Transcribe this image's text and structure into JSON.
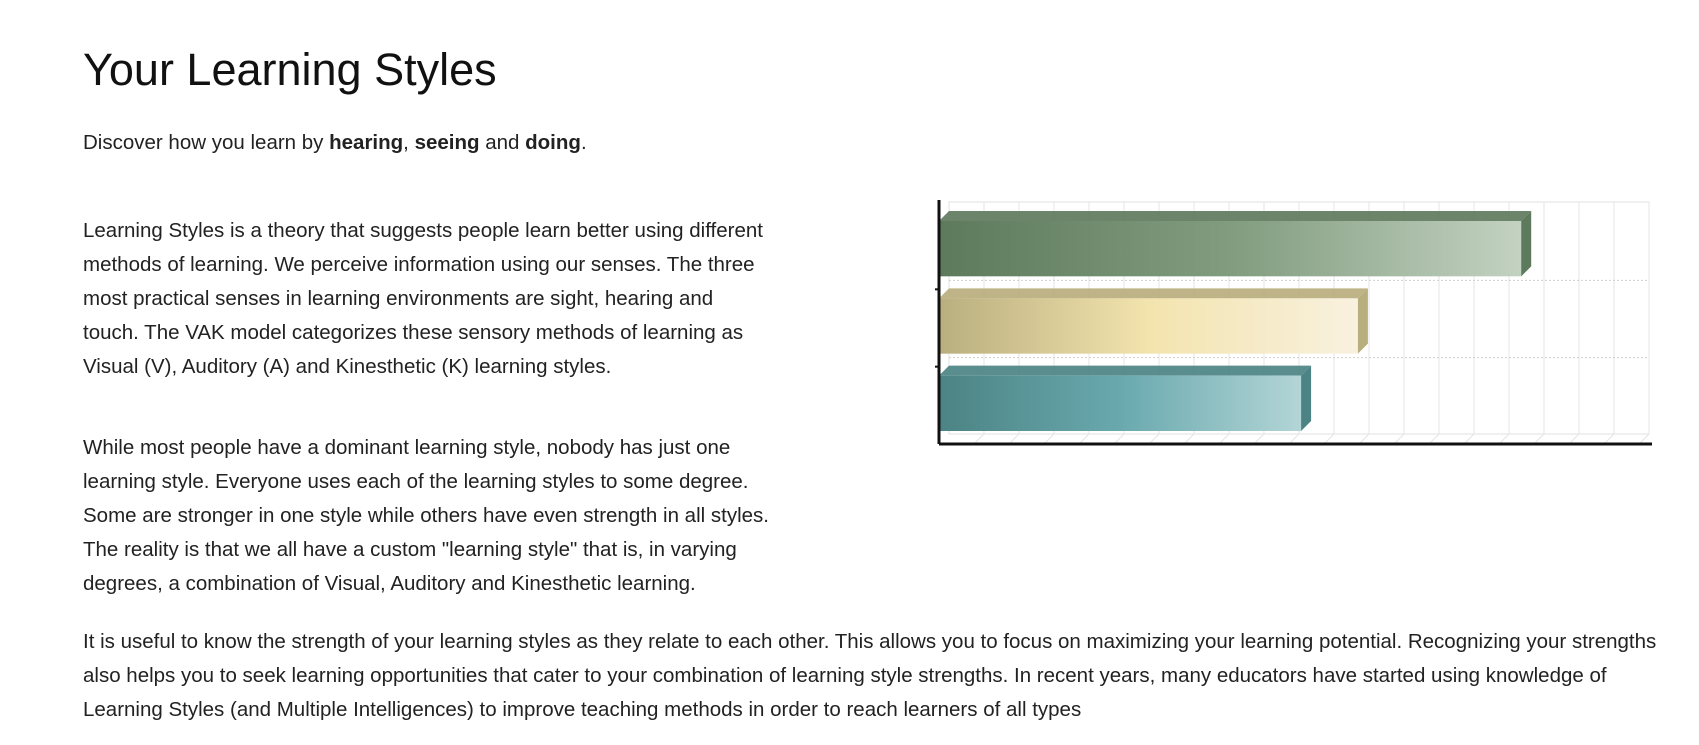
{
  "page": {
    "title": "Your Learning Styles",
    "intro": {
      "before": "Discover how you learn by ",
      "word1": "hearing",
      "sep1": ", ",
      "word2": "seeing",
      "sep2": " and ",
      "word3": "doing",
      "end": "."
    },
    "paragraphs": [
      "Learning Styles is a theory that suggests people learn better using different methods of learning. We perceive information using our senses. The three most practical senses in learning environments are sight, hearing and touch. The VAK model categorizes these sensory methods of learning as Visual (V), Auditory (A) and Kinesthetic (K) learning styles.",
      "While most people have a dominant learning style, nobody has just one learning style. Everyone uses each of the learning styles to some degree. Some are stronger in one style while others have even strength in all styles. The reality is that we all have a custom \"learning style\" that is, in varying degrees, a combination of Visual, Auditory and Kinesthetic learning.",
      "It is useful to know the strength of your learning styles as they relate to each other. This allows you to focus on maximizing your learning potential. Recognizing your strengths also helps you to seek learning opportunities that cater to your combination of learning style strengths. In recent years, many educators have started using knowledge of Learning Styles (and Multiple Intelligences) to improve teaching methods in order to reach learners of all types"
    ]
  },
  "chart_data": {
    "type": "bar",
    "orientation": "horizontal",
    "style": "3d",
    "title": "",
    "xlabel": "",
    "ylabel": "",
    "xlim": [
      0,
      100
    ],
    "grid": true,
    "values": [
      82,
      59,
      51
    ],
    "colors": [
      {
        "dark": "#5e7a5d",
        "mid": "#819c7f",
        "light": "#c3d2c1"
      },
      {
        "dark": "#b9ae7e",
        "mid": "#f3e4ae",
        "light": "#f8f1df"
      },
      {
        "dark": "#4c8384",
        "mid": "#69a9ae",
        "light": "#b3d5d6"
      }
    ]
  }
}
